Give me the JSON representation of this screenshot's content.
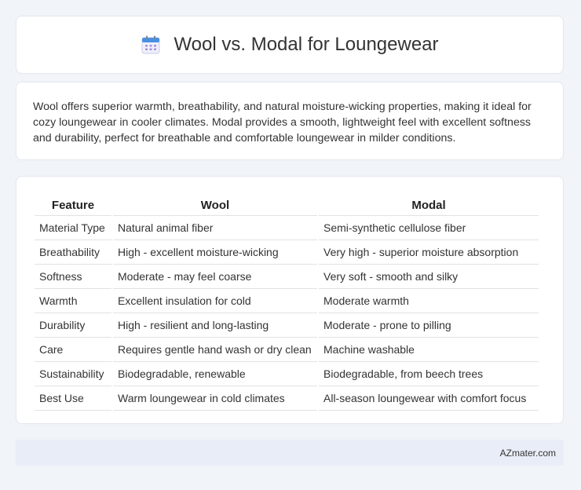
{
  "header": {
    "title": "Wool vs. Modal for Loungewear",
    "icon": "calendar-icon"
  },
  "description": "Wool offers superior warmth, breathability, and natural moisture-wicking properties, making it ideal for cozy loungewear in cooler climates. Modal provides a smooth, lightweight feel with excellent softness and durability, perfect for breathable and comfortable loungewear in milder conditions.",
  "table": {
    "headers": [
      "Feature",
      "Wool",
      "Modal"
    ],
    "rows": [
      [
        "Material Type",
        "Natural animal fiber",
        "Semi-synthetic cellulose fiber"
      ],
      [
        "Breathability",
        "High - excellent moisture-wicking",
        "Very high - superior moisture absorption"
      ],
      [
        "Softness",
        "Moderate - may feel coarse",
        "Very soft - smooth and silky"
      ],
      [
        "Warmth",
        "Excellent insulation for cold",
        "Moderate warmth"
      ],
      [
        "Durability",
        "High - resilient and long-lasting",
        "Moderate - prone to pilling"
      ],
      [
        "Care",
        "Requires gentle hand wash or dry clean",
        "Machine washable"
      ],
      [
        "Sustainability",
        "Biodegradable, renewable",
        "Biodegradable, from beech trees"
      ],
      [
        "Best Use",
        "Warm loungewear in cold climates",
        "All-season loungewear with comfort focus"
      ]
    ]
  },
  "footer": {
    "site": "AZmater.com"
  },
  "colors": {
    "background": "#f1f4f9",
    "card": "#ffffff",
    "footer": "#e8edf7",
    "icon_blue": "#4a90e2",
    "icon_grid": "#a98fd8"
  }
}
